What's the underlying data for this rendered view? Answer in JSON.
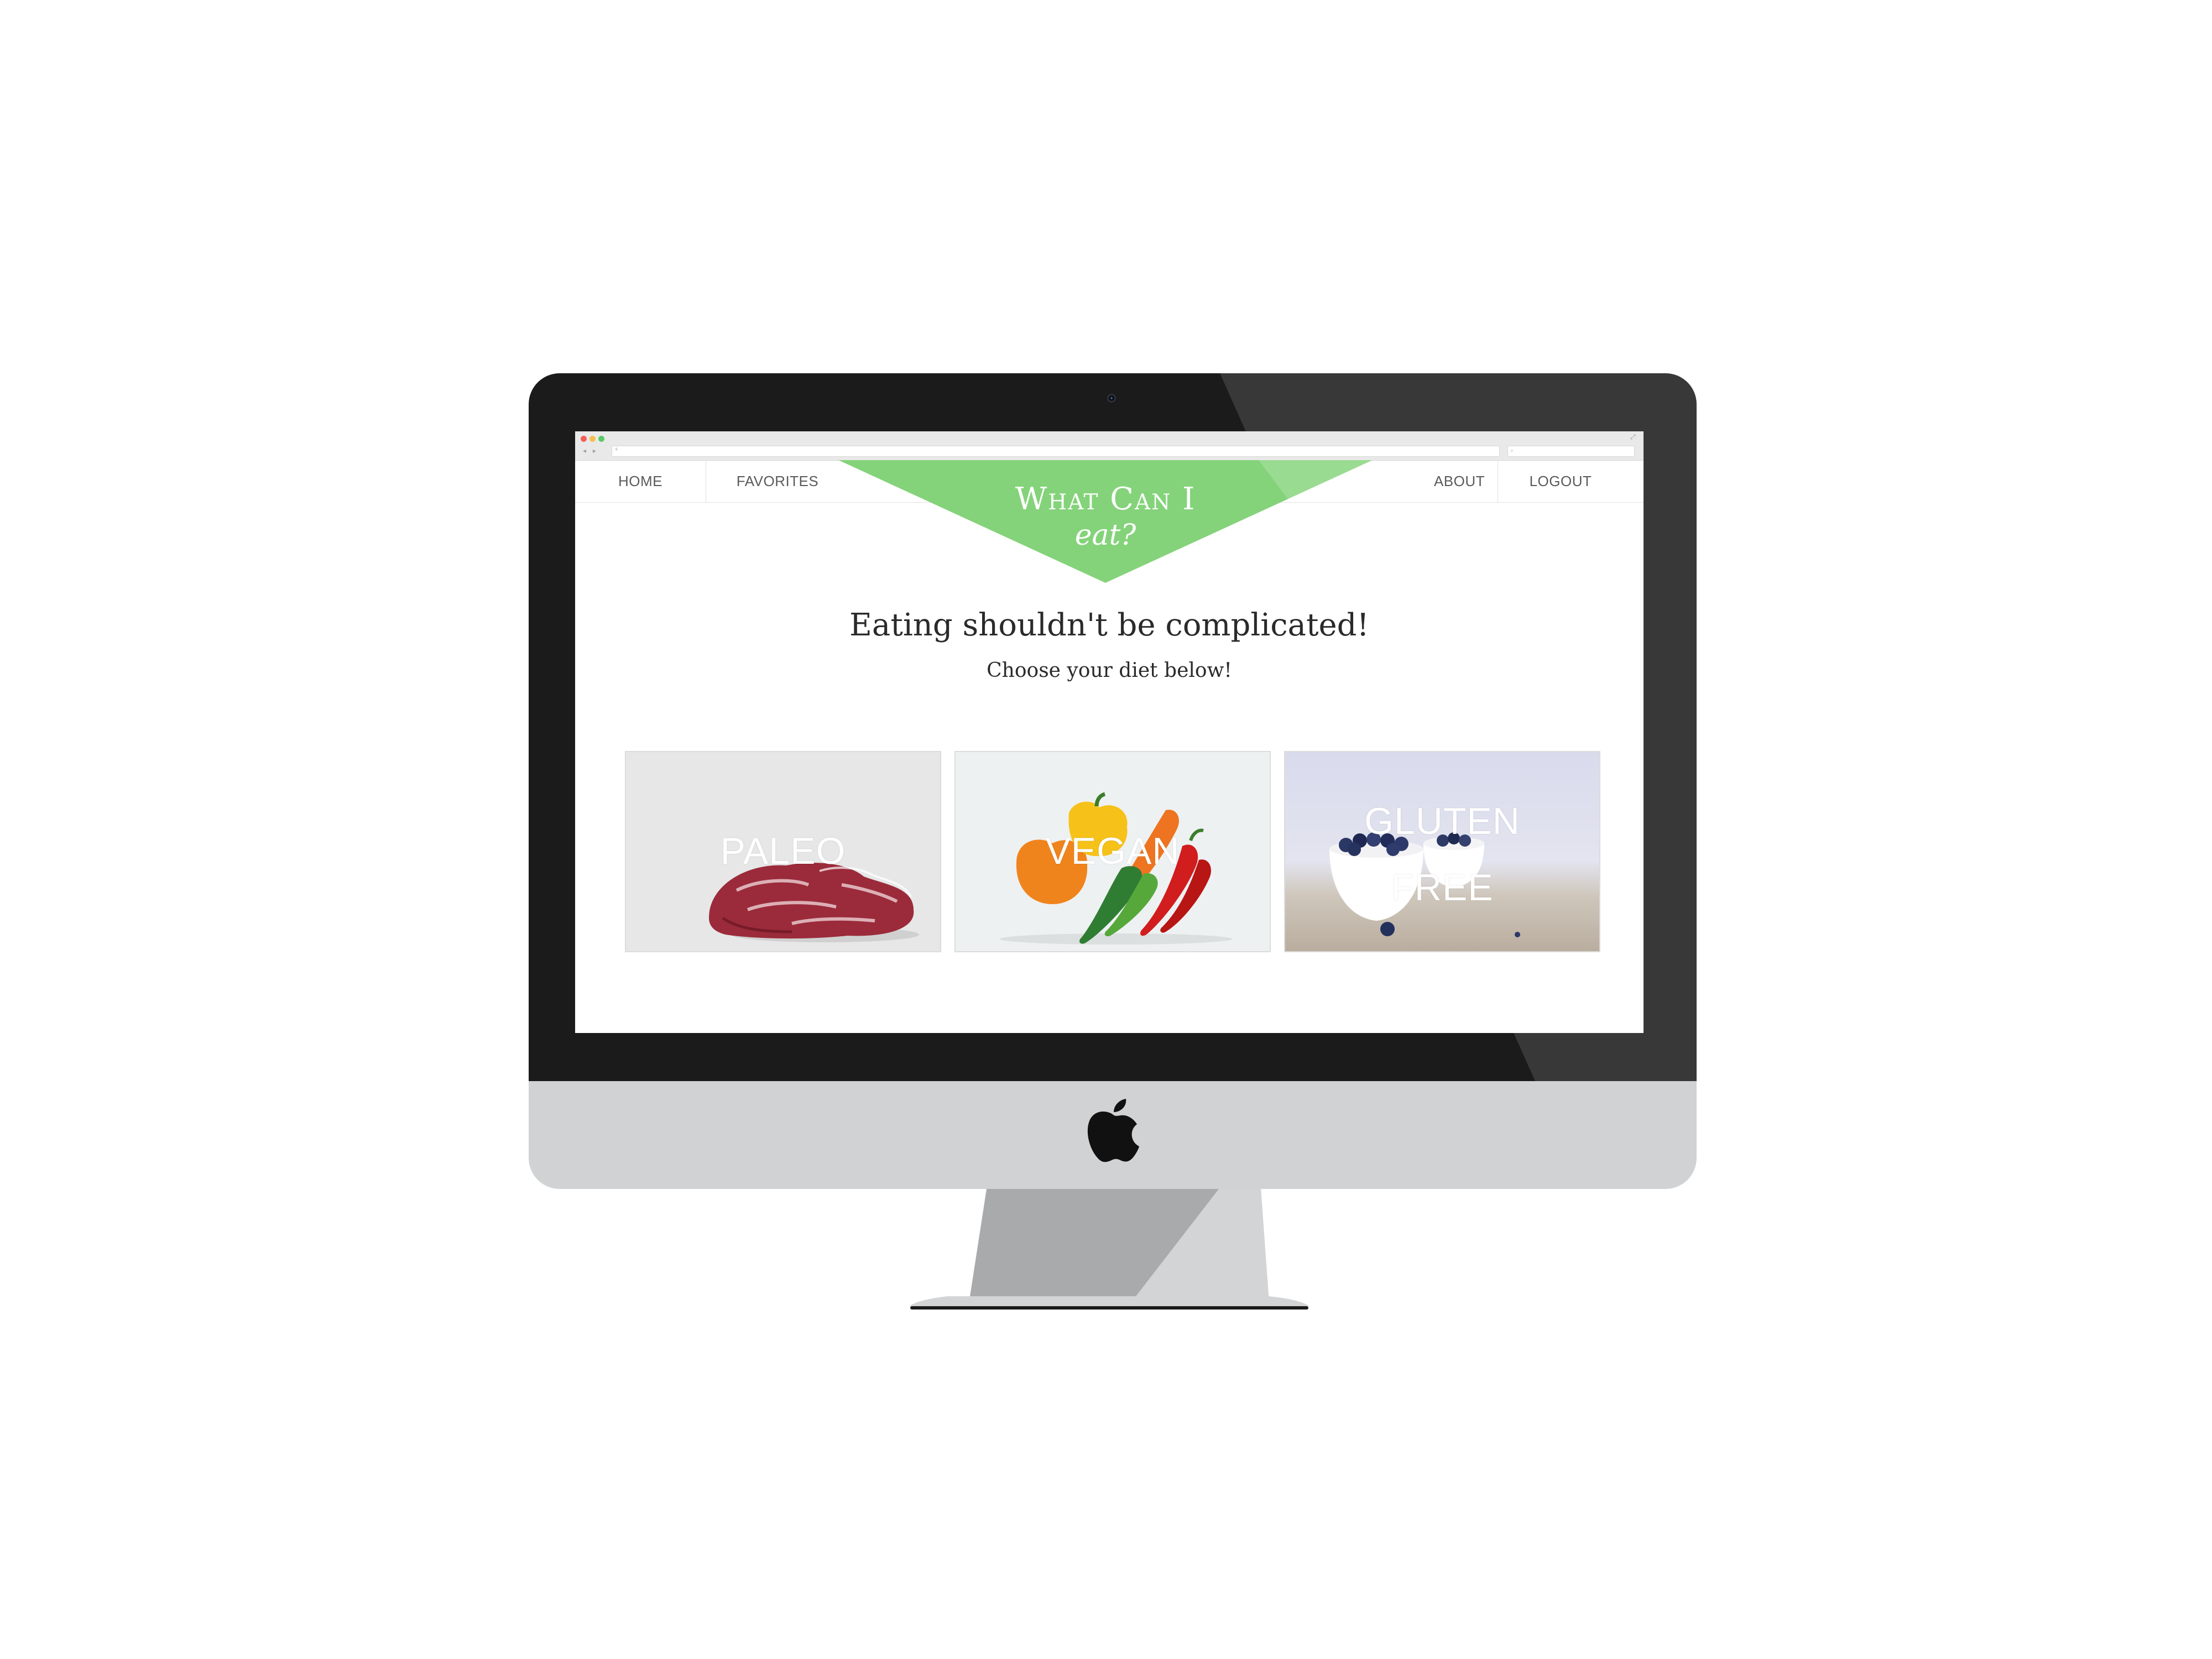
{
  "browser": {
    "nav_arrows": "◂ ▸",
    "address_placeholder": "+",
    "search_glyph": "⌕",
    "expand_glyph": "⤢"
  },
  "site": {
    "nav": {
      "home": "HOME",
      "favorites": "FAVORITES",
      "about": "ABOUT",
      "logout": "LOGOUT"
    },
    "logo": {
      "line1": "What Can I",
      "line2": "eat?",
      "color": "#84d37a"
    },
    "hero": {
      "headline": "Eating shouldn't be complicated!",
      "subline": "Choose your diet below!"
    },
    "diets": [
      {
        "label": "PALEO",
        "image": "raw-meat"
      },
      {
        "label": "VEGAN",
        "image": "vegetables"
      },
      {
        "label_line1": "GLUTEN",
        "label_line2": "FREE",
        "image": "blueberries"
      }
    ]
  },
  "device": {
    "type": "iMac",
    "bezel_color": "#1b1b1c",
    "chin_color": "#d1d2d4",
    "logo": "apple-logo"
  }
}
